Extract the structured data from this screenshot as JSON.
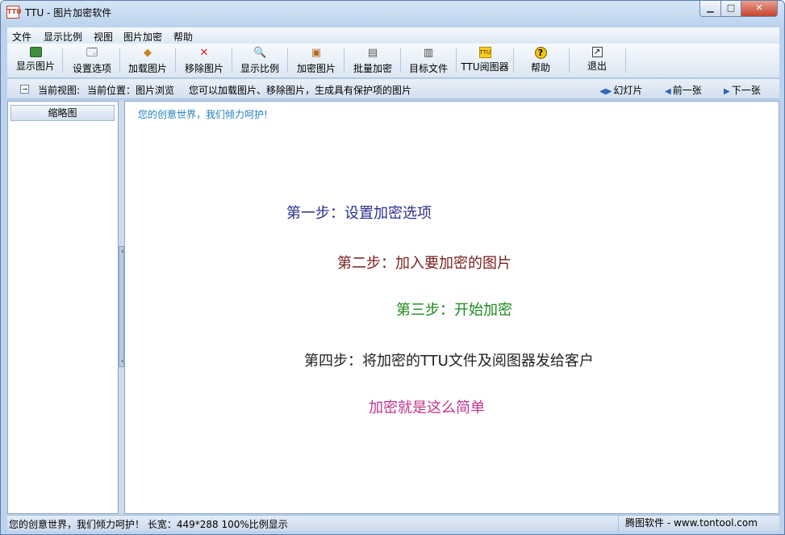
{
  "window": {
    "title": "TTU - 图片加密软件",
    "icon_label": "TTU"
  },
  "menu": [
    "文件",
    "显示比例",
    "视图",
    "图片加密",
    "帮助"
  ],
  "toolbar": [
    {
      "label": "显示图片",
      "icon": "picture-icon"
    },
    {
      "label": "设置选项",
      "icon": "settings-icon"
    },
    {
      "label": "加载图片",
      "icon": "load-image-icon"
    },
    {
      "label": "移除图片",
      "icon": "remove-icon"
    },
    {
      "label": "显示比例",
      "icon": "zoom-icon"
    },
    {
      "label": "加密图片",
      "icon": "encrypt-icon"
    },
    {
      "label": "批量加密",
      "icon": "batch-encrypt-icon"
    },
    {
      "label": "目标文件",
      "icon": "target-file-icon"
    },
    {
      "label": "TTU阅图器",
      "icon": "ttu-viewer-icon"
    },
    {
      "label": "帮助",
      "icon": "help-icon"
    },
    {
      "label": "退出",
      "icon": "exit-icon"
    }
  ],
  "navbar": {
    "current_view": "当前视图:",
    "location": "当前位置：图片浏览",
    "hint": "您可以加载图片、移除图片，生成具有保护项的图片",
    "slideshow": "幻灯片",
    "prev": "前一张",
    "next": "下一张"
  },
  "sidebar": {
    "header": "缩略图"
  },
  "main": {
    "slogan": "您的创意世界，我们倾力呵护!",
    "steps": [
      {
        "text": "第一步：设置加密选项",
        "color": "#2b2f8f"
      },
      {
        "text": "第二步：加入要加密的图片",
        "color": "#7a1f1f"
      },
      {
        "text": "第三步：开始加密",
        "color": "#1e8a1e"
      },
      {
        "text": "第四步：将加密的TTU文件及阅图器发给客户",
        "color": "#222222"
      },
      {
        "text": "加密就是这么简单",
        "color": "#c0348e"
      }
    ]
  },
  "statusbar": {
    "left": "您的创意世界，我们倾力呵护！  长宽：449*288    100%比例显示",
    "right": "腾图软件 - www.tontool.com"
  }
}
